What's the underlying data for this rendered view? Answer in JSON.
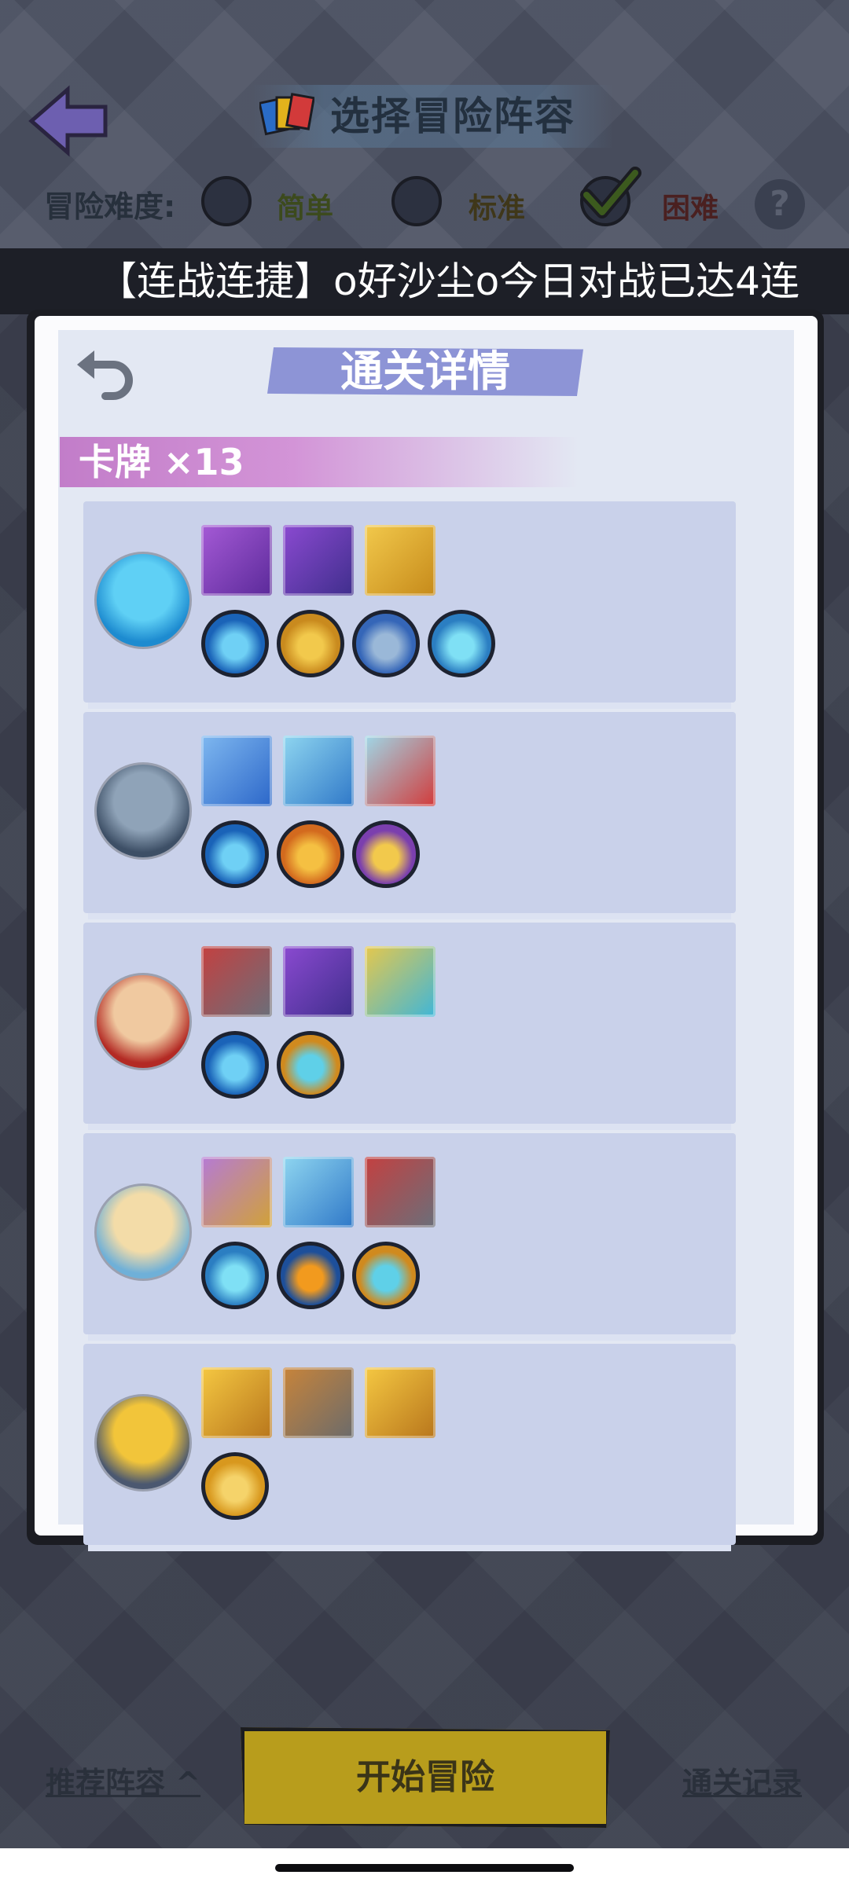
{
  "header": {
    "title": "选择冒险阵容",
    "difficulty_label": "冒险难度:",
    "difficulties": [
      {
        "label": "简单",
        "selected": false,
        "color": "#3c4a1d"
      },
      {
        "label": "标准",
        "selected": false,
        "color": "#3f3719"
      },
      {
        "label": "困难",
        "selected": true,
        "color": "#4a2020"
      }
    ],
    "help_glyph": "?"
  },
  "ticker": {
    "text": "【连战连捷】o好沙尘o今日对战已达4连"
  },
  "modal": {
    "title": "通关详情",
    "cards_label": "卡牌 ×13"
  },
  "heroes": [
    {
      "name_icon": "ice-spirit-avatar",
      "items": [
        "purple-sword",
        "purple-spear",
        "golden-shield"
      ],
      "skills": [
        "blue-gem-skill",
        "gold-gem-skill",
        "blue-storm-skill",
        "blue-lightning-skill"
      ]
    },
    {
      "name_icon": "frost-demon-avatar",
      "items": [
        "ice-crown",
        "blue-crest",
        "red-crab-claw"
      ],
      "skills": [
        "blue-gem-skill",
        "fire-skill",
        "purple-blossom-skill"
      ]
    },
    {
      "name_icon": "red-hat-mage-avatar",
      "items": [
        "red-cannon",
        "purple-spear",
        "cyan-blade"
      ],
      "skills": [
        "blue-gem-skill",
        "cyan-claw-skill"
      ]
    },
    {
      "name_icon": "blonde-princess-avatar",
      "items": [
        "shield-wreath",
        "blue-crest",
        "red-cannon"
      ],
      "skills": [
        "blue-lightning-skill",
        "torch-skill",
        "cyan-claw-skill"
      ]
    },
    {
      "name_icon": "golden-knight-avatar",
      "items": [
        "gold-helmet",
        "stone-armor",
        "gold-helmet"
      ],
      "skills": [
        "gold-beast-skill"
      ]
    }
  ],
  "footer": {
    "recommend": "推荐阵容",
    "start": "开始冒险",
    "records": "通关记录"
  }
}
